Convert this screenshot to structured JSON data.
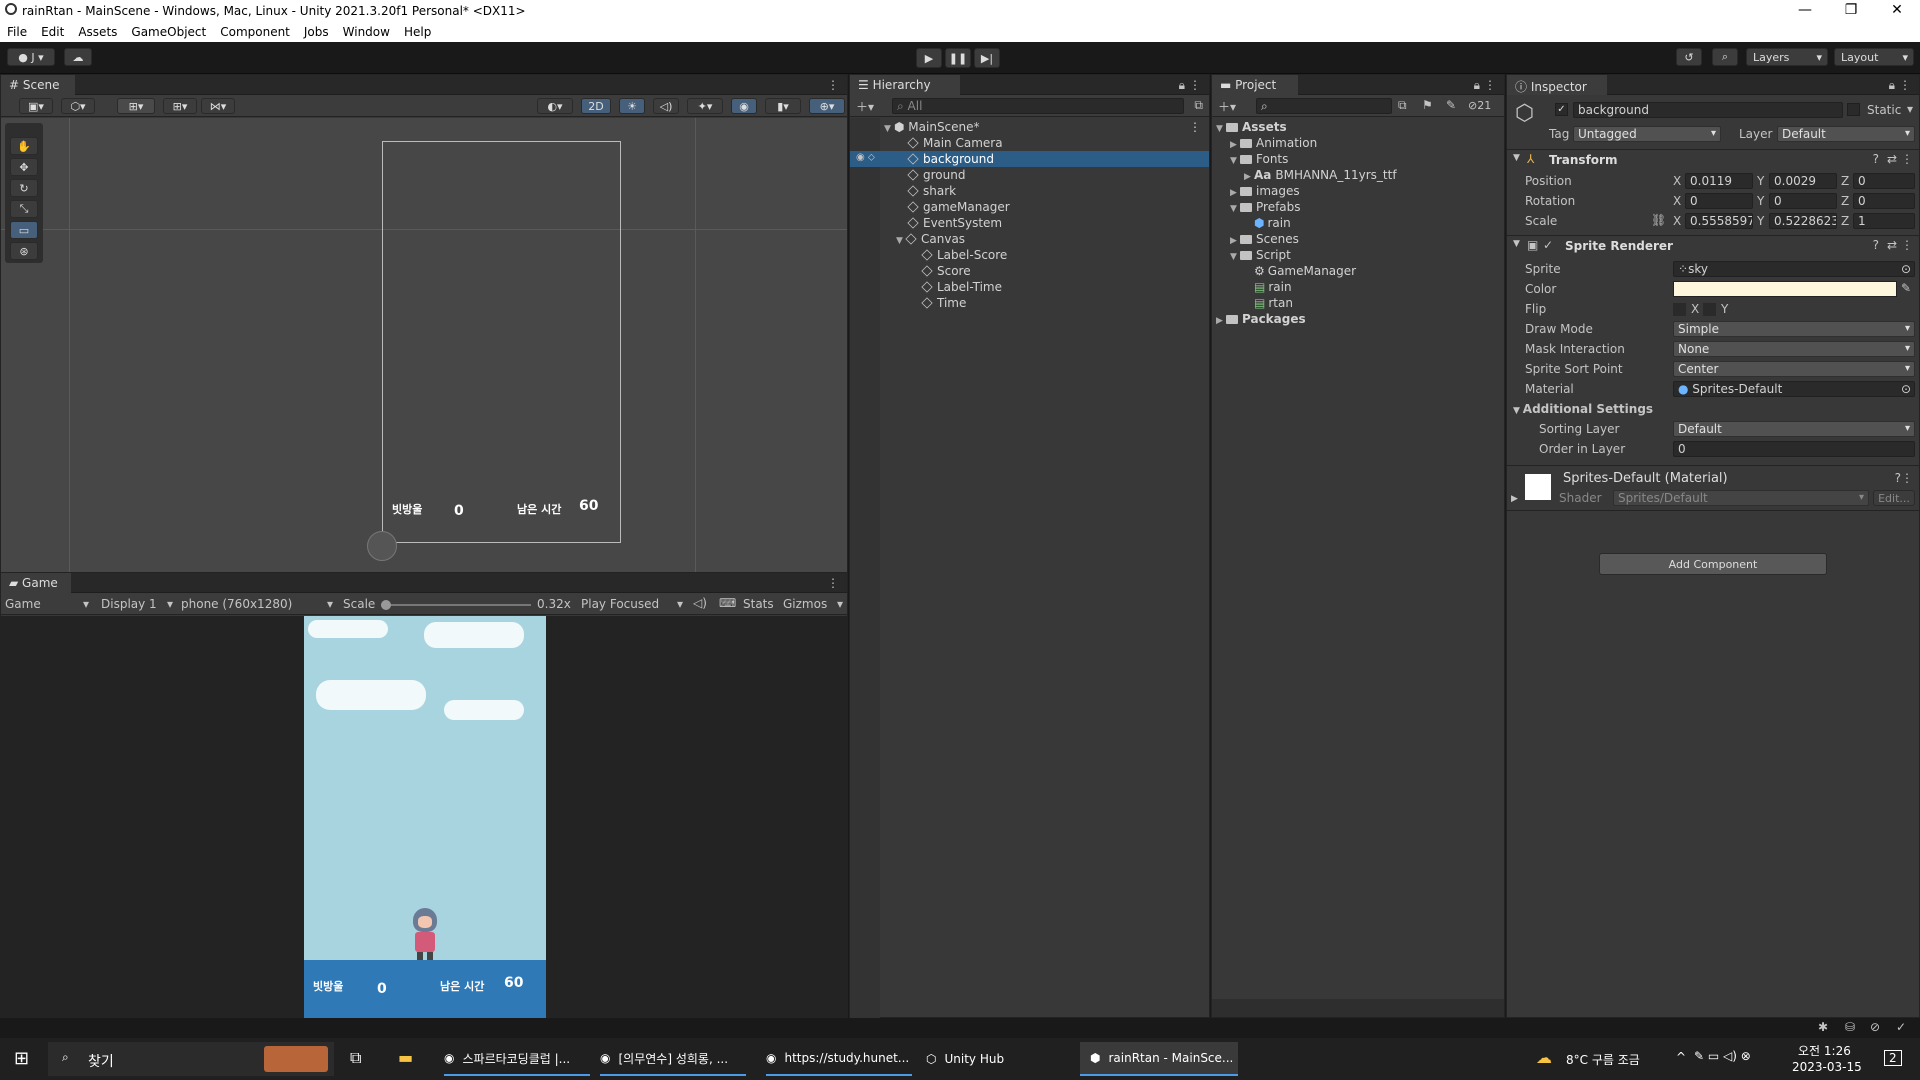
{
  "window": {
    "title": "rainRtan - MainScene - Windows, Mac, Linux - Unity 2021.3.20f1 Personal* <DX11>",
    "minimize": "—",
    "maximize": "❐",
    "close": "✕"
  },
  "menu": [
    "File",
    "Edit",
    "Assets",
    "GameObject",
    "Component",
    "Jobs",
    "Window",
    "Help"
  ],
  "toolbar": {
    "account": "J",
    "layers": "Layers",
    "layout": "Layout"
  },
  "scene": {
    "tab": "Scene",
    "mode2d": "2D",
    "preview": {
      "label_score": "빗방울",
      "score": "0",
      "label_time": "남은 시간",
      "time": "60"
    }
  },
  "game": {
    "tab": "Game",
    "display_mode": "Game",
    "display": "Display 1",
    "resolution": "phone (760x1280)",
    "scale_label": "Scale",
    "scale_value": "0.32x",
    "play_focused": "Play Focused",
    "stats": "Stats",
    "gizmos": "Gizmos",
    "hud": {
      "label_score": "빗방울",
      "score": "0",
      "label_time": "남은 시간",
      "time": "60"
    }
  },
  "hierarchy": {
    "tab": "Hierarchy",
    "search_placeholder": "All",
    "scene_name": "MainScene*",
    "items": [
      "Main Camera",
      "background",
      "ground",
      "shark",
      "gameManager",
      "EventSystem",
      "Canvas"
    ],
    "canvas_children": [
      "Label-Score",
      "Score",
      "Label-Time",
      "Time"
    ],
    "selected": "background"
  },
  "project": {
    "tab": "Project",
    "count": "21",
    "root": "Assets",
    "tree": {
      "animation": "Animation",
      "fonts": "Fonts",
      "font_file": "BMHANNA_11yrs_ttf",
      "font_prefix": "Aa",
      "images": "images",
      "prefabs": "Prefabs",
      "prefab_rain": "rain",
      "scenes": "Scenes",
      "script": "Script",
      "scripts": [
        "GameManager",
        "rain",
        "rtan"
      ],
      "packages": "Packages"
    }
  },
  "inspector": {
    "tab": "Inspector",
    "object_name": "background",
    "static_label": "Static",
    "tag_label": "Tag",
    "tag_value": "Untagged",
    "layer_label": "Layer",
    "layer_value": "Default",
    "transform": {
      "title": "Transform",
      "position_label": "Position",
      "position": [
        "0.0119",
        "0.0029",
        "0"
      ],
      "rotation_label": "Rotation",
      "rotation": [
        "0",
        "0",
        "0"
      ],
      "scale_label": "Scale",
      "scale": [
        "0.5558597",
        "0.5228623",
        "1"
      ],
      "axes": [
        "X",
        "Y",
        "Z"
      ]
    },
    "sprite_renderer": {
      "title": "Sprite Renderer",
      "sprite_label": "Sprite",
      "sprite": "sky",
      "color_label": "Color",
      "color": "#fdf8dd",
      "flip_label": "Flip",
      "flip_x": "X",
      "flip_y": "Y",
      "draw_mode_label": "Draw Mode",
      "draw_mode": "Simple",
      "mask_label": "Mask Interaction",
      "mask": "None",
      "sort_point_label": "Sprite Sort Point",
      "sort_point": "Center",
      "material_label": "Material",
      "material": "Sprites-Default",
      "additional_label": "Additional Settings",
      "sorting_layer_label": "Sorting Layer",
      "sorting_layer": "Default",
      "order_label": "Order in Layer",
      "order": "0"
    },
    "material": {
      "title": "Sprites-Default (Material)",
      "shader_label": "Shader",
      "shader": "Sprites/Default",
      "edit": "Edit..."
    },
    "add_component": "Add Component"
  },
  "taskbar": {
    "search": "찾기",
    "tasks": [
      "스파르타코딩클럽 |...",
      "[의무연수] 성희롱, ...",
      "https://study.hunet...",
      "Unity Hub",
      "rainRtan - MainSce..."
    ],
    "weather": "8°C 구름 조금",
    "time": "오전 1:26",
    "date": "2023-03-15",
    "notifications": "2"
  },
  "colors": {
    "selection": "#2c5d87",
    "sky": "#a8d4e0",
    "hud_bar": "#2f79b7"
  }
}
